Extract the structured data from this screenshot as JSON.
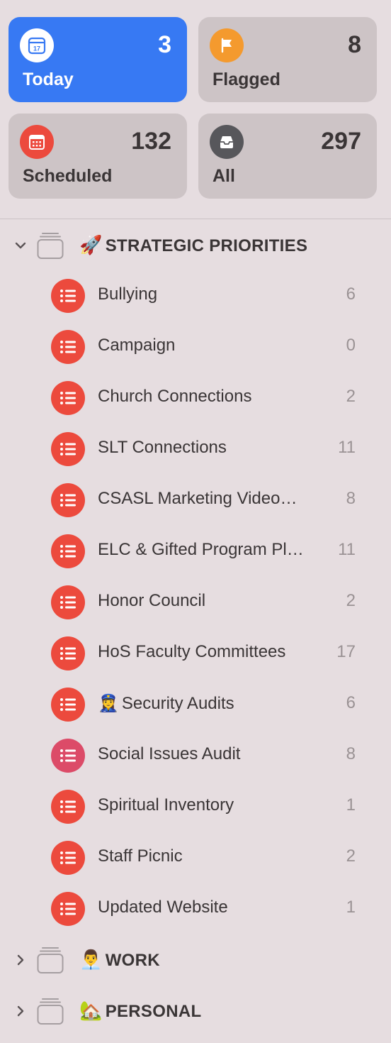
{
  "smart_lists": {
    "today": {
      "label": "Today",
      "count": "3",
      "date_num": "17",
      "color": "#3779f3"
    },
    "flagged": {
      "label": "Flagged",
      "count": "8",
      "color": "#f49a2e"
    },
    "scheduled": {
      "label": "Scheduled",
      "count": "132",
      "color": "#ec4a3d"
    },
    "all": {
      "label": "All",
      "count": "297",
      "color": "#57575b"
    }
  },
  "groups": {
    "strategic": {
      "emoji": "🚀",
      "title": "STRATEGIC PRIORITIES",
      "expanded": true,
      "lists": [
        {
          "name": "Bullying",
          "count": "6"
        },
        {
          "name": "Campaign",
          "count": "0"
        },
        {
          "name": "Church Connections",
          "count": "2"
        },
        {
          "name": "SLT Connections",
          "count": "11"
        },
        {
          "name": "CSASL Marketing Video…",
          "count": "8"
        },
        {
          "name": "ELC & Gifted Program Pl…",
          "count": "11"
        },
        {
          "name": "Honor Council",
          "count": "2"
        },
        {
          "name": "HoS Faculty Committees",
          "count": "17"
        },
        {
          "name": "Security Audits",
          "emoji": "👮‍♀️",
          "count": "6"
        },
        {
          "name": "Social Issues Audit",
          "count": "8"
        },
        {
          "name": "Spiritual Inventory",
          "count": "1"
        },
        {
          "name": "Staff Picnic",
          "count": "2"
        },
        {
          "name": "Updated Website",
          "count": "1"
        }
      ]
    },
    "work": {
      "emoji": "👨‍💼",
      "title": "WORK",
      "expanded": false
    },
    "personal": {
      "emoji": "🏡",
      "title": "PERSONAL",
      "expanded": false
    }
  }
}
